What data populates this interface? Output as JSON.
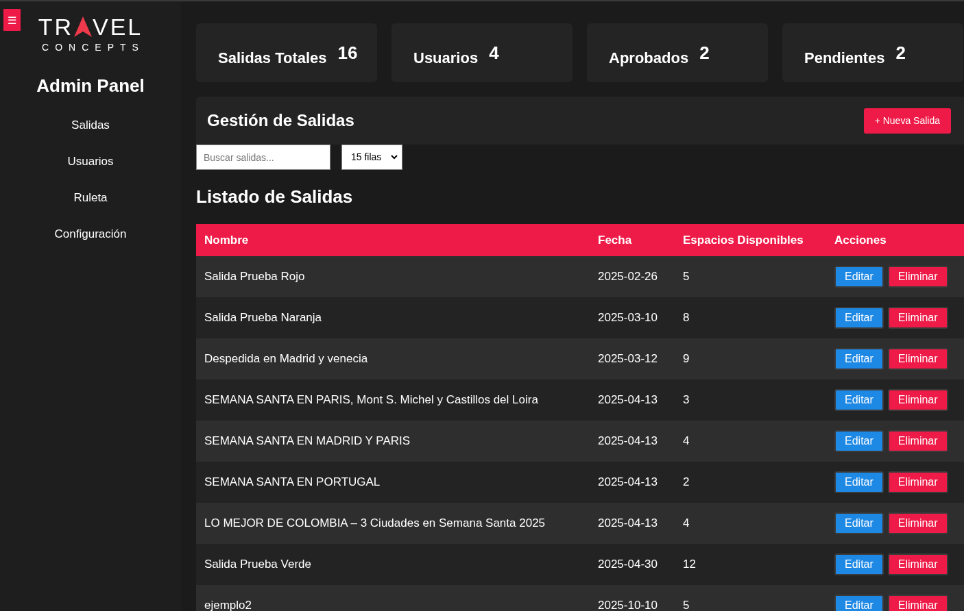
{
  "sidebar": {
    "menu_icon": "☰",
    "logo": {
      "word_1": "TR",
      "word_2": "VEL",
      "subtitle": "CONCEPTS"
    },
    "title": "Admin Panel",
    "items": [
      {
        "label": "Salidas"
      },
      {
        "label": "Usuarios"
      },
      {
        "label": "Ruleta"
      },
      {
        "label": "Configuración"
      }
    ]
  },
  "stats": [
    {
      "label": "Salidas Totales",
      "value": "16"
    },
    {
      "label": "Usuarios",
      "value": "4"
    },
    {
      "label": "Aprobados",
      "value": "2"
    },
    {
      "label": "Pendientes",
      "value": "2"
    }
  ],
  "management": {
    "title": "Gestión de Salidas",
    "new_button": "+ Nueva Salida",
    "search": {
      "placeholder": "Buscar salidas..."
    },
    "rows_select": "15 filas"
  },
  "table": {
    "title": "Listado de Salidas",
    "columns": [
      "Nombre",
      "Fecha",
      "Espacios Disponibles",
      "Acciones"
    ],
    "rows": [
      {
        "name": "Salida Prueba Rojo",
        "date": "2025-02-26",
        "spaces": "5",
        "edit": "Editar",
        "delete": "Eliminar"
      },
      {
        "name": "Salida Prueba Naranja",
        "date": "2025-03-10",
        "spaces": "8",
        "edit": "Editar",
        "delete": "Eliminar"
      },
      {
        "name": "Despedida en Madrid y venecia",
        "date": "2025-03-12",
        "spaces": "9",
        "edit": "Editar",
        "delete": "Eliminar"
      },
      {
        "name": "SEMANA SANTA EN PARIS, Mont S. Michel y Castillos del Loira",
        "date": "2025-04-13",
        "spaces": "3",
        "edit": "Editar",
        "delete": "Eliminar"
      },
      {
        "name": "SEMANA SANTA EN MADRID Y PARIS",
        "date": "2025-04-13",
        "spaces": "4",
        "edit": "Editar",
        "delete": "Eliminar"
      },
      {
        "name": "SEMANA SANTA EN PORTUGAL",
        "date": "2025-04-13",
        "spaces": "2",
        "edit": "Editar",
        "delete": "Eliminar"
      },
      {
        "name": "LO MEJOR DE COLOMBIA – 3 Ciudades en Semana Santa 2025",
        "date": "2025-04-13",
        "spaces": "4",
        "edit": "Editar",
        "delete": "Eliminar"
      },
      {
        "name": "Salida Prueba Verde",
        "date": "2025-04-30",
        "spaces": "12",
        "edit": "Editar",
        "delete": "Eliminar"
      },
      {
        "name": "ejemplo2",
        "date": "2025-10-10",
        "spaces": "5",
        "edit": "Editar",
        "delete": "Eliminar"
      }
    ]
  }
}
